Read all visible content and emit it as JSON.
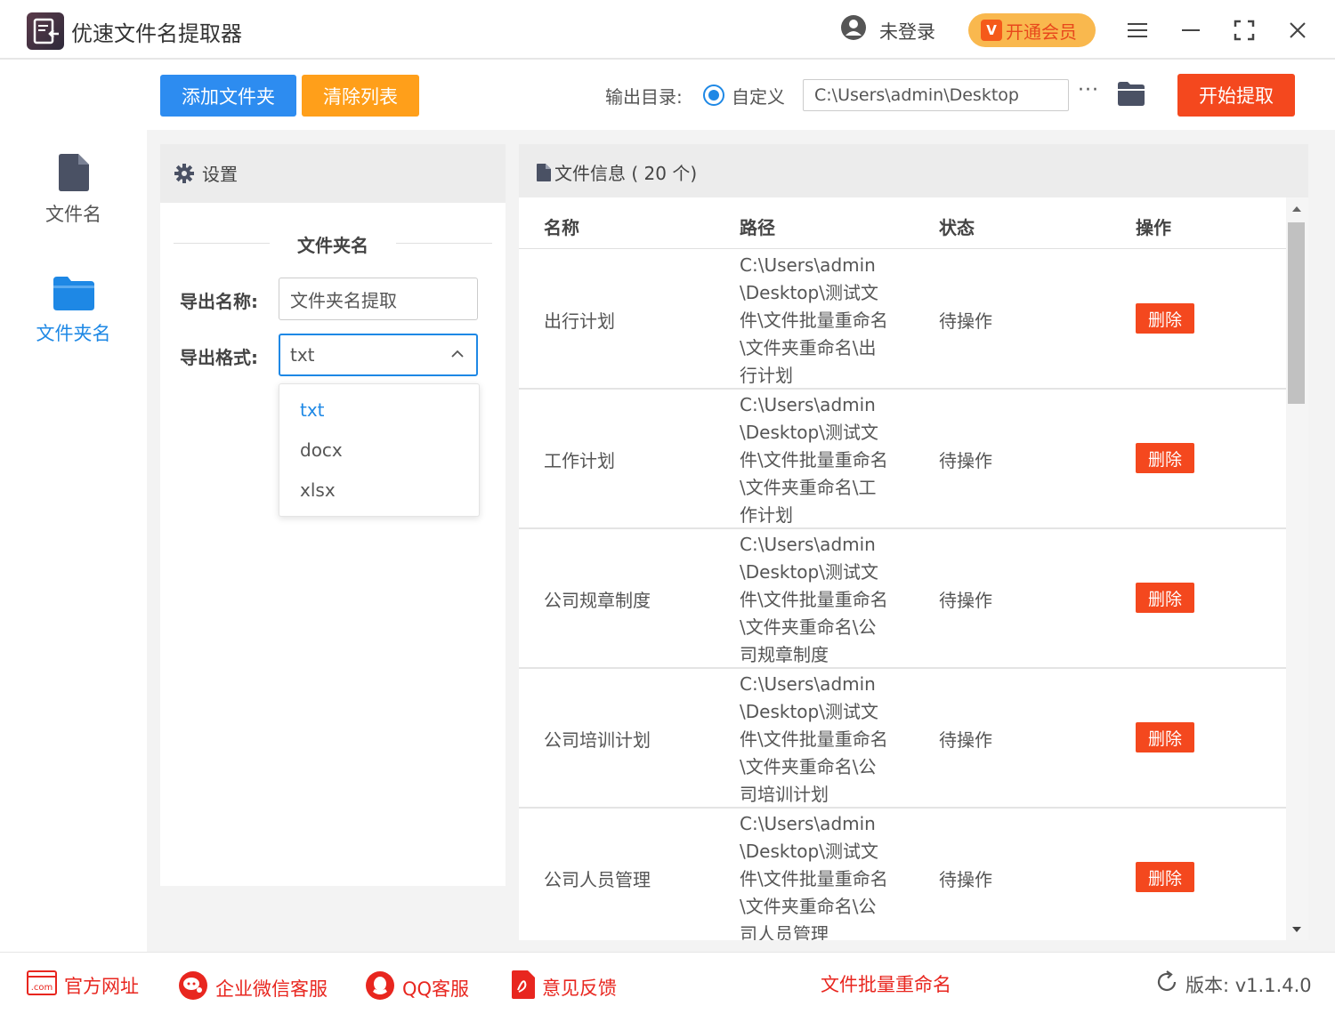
{
  "window": {
    "title": "优速文件名提取器",
    "user_status": "未登录",
    "vip_badge": "V",
    "vip_label": "开通会员"
  },
  "sidebar": {
    "items": [
      {
        "label": "文件名",
        "icon": "file-icon",
        "active": false
      },
      {
        "label": "文件夹名",
        "icon": "folder-icon",
        "active": true
      }
    ]
  },
  "toolbar": {
    "add_folder": "添加文件夹",
    "clear_list": "清除列表",
    "output_dir_label": "输出目录:",
    "radio_label": "自定义",
    "output_path": "C:\\Users\\admin\\Desktop",
    "more": "···",
    "start": "开始提取"
  },
  "settings": {
    "title": "设置",
    "section": "文件夹名",
    "export_name_label": "导出名称:",
    "export_name_value": "文件夹名提取",
    "export_format_label": "导出格式:",
    "export_format_value": "txt",
    "format_options": [
      "txt",
      "docx",
      "xlsx"
    ]
  },
  "files": {
    "title": "文件信息 ( 20 个)",
    "columns": [
      "名称",
      "路径",
      "状态",
      "操作"
    ],
    "rows": [
      {
        "name": "出行计划",
        "path": "C:\\Users\\admin\\Desktop\\测试文件\\文件批量重命名\\文件夹重命名\\出行计划",
        "status": "待操作",
        "action": "删除"
      },
      {
        "name": "工作计划",
        "path": "C:\\Users\\admin\\Desktop\\测试文件\\文件批量重命名\\文件夹重命名\\工作计划",
        "status": "待操作",
        "action": "删除"
      },
      {
        "name": "公司规章制度",
        "path": "C:\\Users\\admin\\Desktop\\测试文件\\文件批量重命名\\文件夹重命名\\公司规章制度",
        "status": "待操作",
        "action": "删除"
      },
      {
        "name": "公司培训计划",
        "path": "C:\\Users\\admin\\Desktop\\测试文件\\文件批量重命名\\文件夹重命名\\公司培训计划",
        "status": "待操作",
        "action": "删除"
      },
      {
        "name": "公司人员管理",
        "path": "C:\\Users\\admin\\Desktop\\测试文件\\文件批量重命名\\文件夹重命名\\公司人员管理",
        "status": "待操作",
        "action": "删除"
      }
    ]
  },
  "footer": {
    "website": "官方网址",
    "wechat": "企业微信客服",
    "qq": "QQ客服",
    "feedback": "意见反馈",
    "rename_link": "文件批量重命名",
    "version": "版本: v1.1.4.0",
    "com_badge": ".com"
  },
  "colors": {
    "accent_blue": "#1e88e5",
    "button_blue": "#2d8cf0",
    "button_orange": "#ff9f1a",
    "start_red": "#f4481e",
    "footer_red": "#e8261f"
  }
}
